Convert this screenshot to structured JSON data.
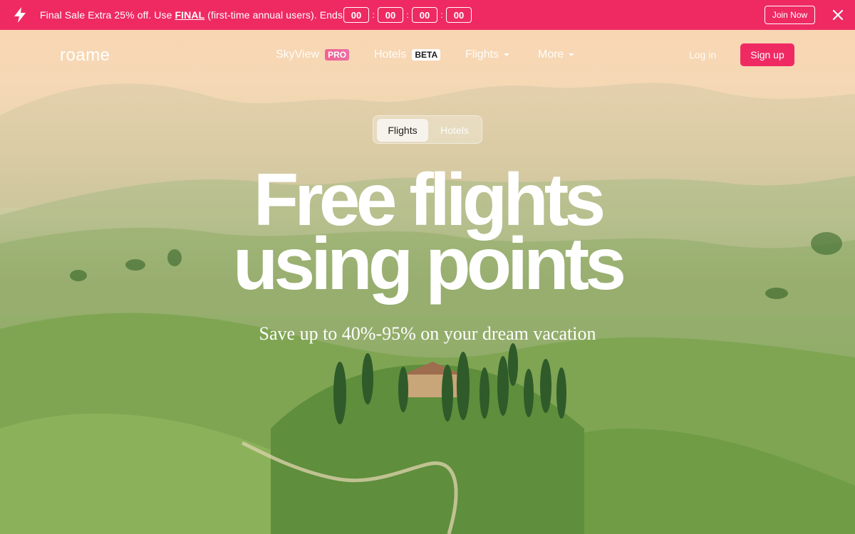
{
  "promo": {
    "text_before": "Final Sale Extra 25% off. Use ",
    "code": "FINAL",
    "text_after": " (first-time annual users). Ends",
    "timer": [
      "00",
      "00",
      "00",
      "00"
    ],
    "separator": ":",
    "join_label": "Join Now",
    "icon_bolt": "lightning-icon",
    "icon_close": "close-icon",
    "color": "#ef2a63"
  },
  "nav": {
    "logo": "roame",
    "skyview": {
      "label": "SkyView",
      "badge": "PRO"
    },
    "hotels": {
      "label": "Hotels",
      "badge": "BETA"
    },
    "flights": {
      "label": "Flights"
    },
    "more": {
      "label": "More"
    },
    "login": "Log in",
    "signup": "Sign up"
  },
  "toggle": {
    "options": [
      "Flights",
      "Hotels"
    ],
    "selected": "Flights"
  },
  "hero": {
    "line1": "Free flights",
    "line2": "using points",
    "subtitle": "Save up to 40%-95% on your dream vacation"
  }
}
